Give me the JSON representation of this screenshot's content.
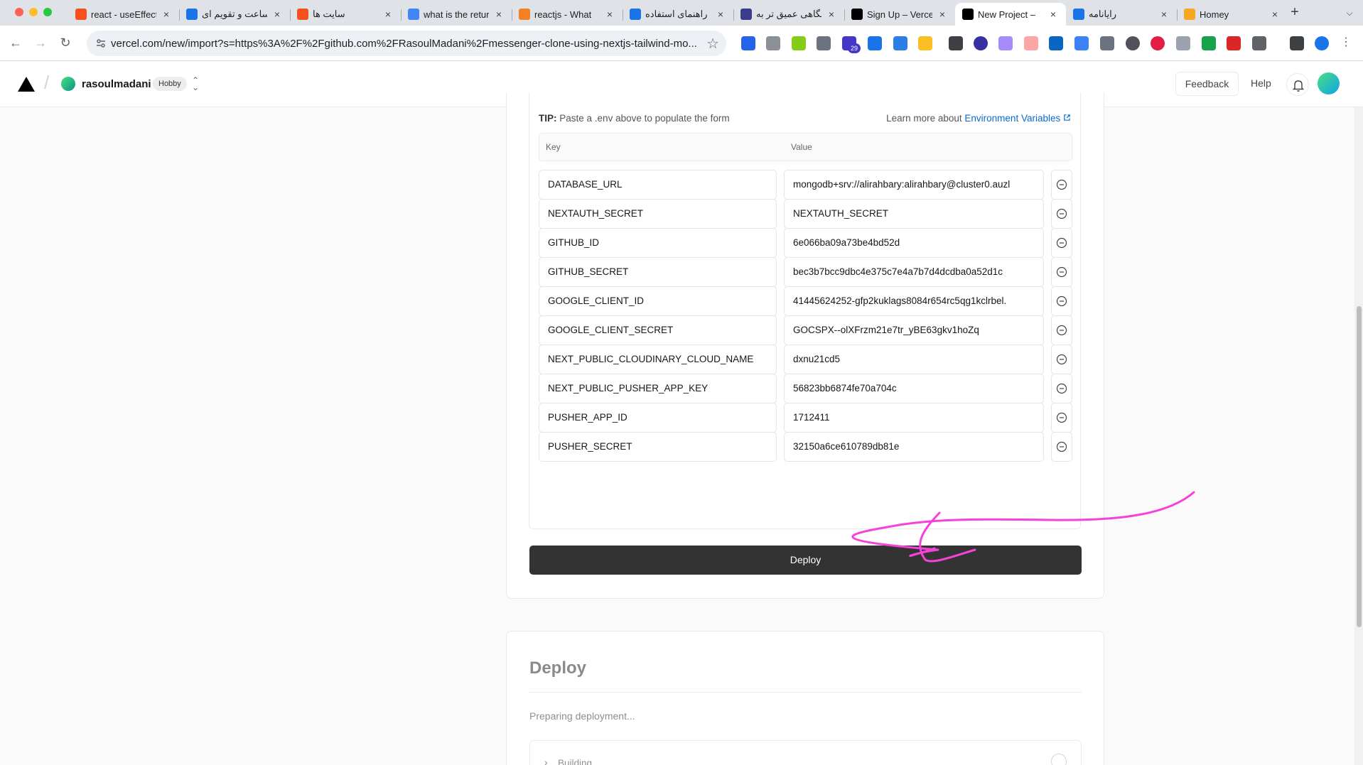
{
  "browser": {
    "tabs": [
      {
        "title": "react - useEffect",
        "favicon": "red-stack-icon",
        "color": "#f4511e"
      },
      {
        "title": "ساعت و تقویم ای",
        "favicon": "clock-site-icon",
        "color": "#1a73e8"
      },
      {
        "title": "سایت ها",
        "favicon": "red-stack-icon",
        "color": "#f4511e"
      },
      {
        "title": "what is the return",
        "favicon": "google-icon",
        "color": "#4285f4"
      },
      {
        "title": "reactjs - What",
        "favicon": "stackoverflow-icon",
        "color": "#f48024"
      },
      {
        "title": "راهنمای استفاده",
        "favicon": "play-circle-icon",
        "color": "#1a73e8"
      },
      {
        "title": "نگاهی عمیق تر به",
        "favicon": "app-icon",
        "color": "#3c3c8c"
      },
      {
        "title": "Sign Up – Vercel",
        "favicon": "vercel-icon",
        "color": "#000000"
      },
      {
        "title": "New Project –",
        "favicon": "vercel-icon",
        "color": "#000000"
      },
      {
        "title": "رایانامه",
        "favicon": "mail-icon",
        "color": "#1a73e8"
      },
      {
        "title": "Homey",
        "favicon": "homey-icon",
        "color": "#f5a623"
      }
    ],
    "active_tab": 8,
    "tab_close": "×",
    "new_tab": "+",
    "url": "vercel.com/new/import?s=https%3A%2F%2Fgithub.com%2FRasoulMadani%2Fmessenger-clone-using-nextjs-tailwind-mo...",
    "extension_badge": "29"
  },
  "header": {
    "team_name": "rasoulmadani",
    "plan_badge": "Hobby",
    "feedback_label": "Feedback",
    "help_label": "Help"
  },
  "env": {
    "tip_label": "TIP:",
    "tip_text": "Paste a .env above to populate the form",
    "learn_prefix": "Learn more about",
    "learn_link": "Environment Variables",
    "col_key": "Key",
    "col_value": "Value",
    "rows": [
      {
        "key": "DATABASE_URL",
        "value": "mongodb+srv://alirahbary:alirahbary@cluster0.auzl"
      },
      {
        "key": "NEXTAUTH_SECRET",
        "value": "NEXTAUTH_SECRET"
      },
      {
        "key": "GITHUB_ID",
        "value": "6e066ba09a73be4bd52d"
      },
      {
        "key": "GITHUB_SECRET",
        "value": "bec3b7bcc9dbc4e375c7e4a7b7d4dcdba0a52d1c"
      },
      {
        "key": "GOOGLE_CLIENT_ID",
        "value": "41445624252-gfp2kuklags8084r654rc5qg1kclrbel."
      },
      {
        "key": "GOOGLE_CLIENT_SECRET",
        "value": "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"
      },
      {
        "key": "NEXT_PUBLIC_CLOUDINARY_CLOUD_NAME",
        "value": "dxnu21cd5"
      },
      {
        "key": "NEXT_PUBLIC_PUSHER_APP_KEY",
        "value": "56823bb6874fe70a704c"
      },
      {
        "key": "PUSHER_APP_ID",
        "value": "1712411"
      },
      {
        "key": "PUSHER_SECRET",
        "value": "32150a6ce610789db81e"
      }
    ]
  },
  "deploy_button_label": "Deploy",
  "deploy_section": {
    "title": "Deploy",
    "status": "Preparing deployment...",
    "step_label": "Building"
  },
  "colors": {
    "accent_link": "#0b6bcb",
    "button_dark": "#333333",
    "annotation_stroke": "#f542d8"
  }
}
